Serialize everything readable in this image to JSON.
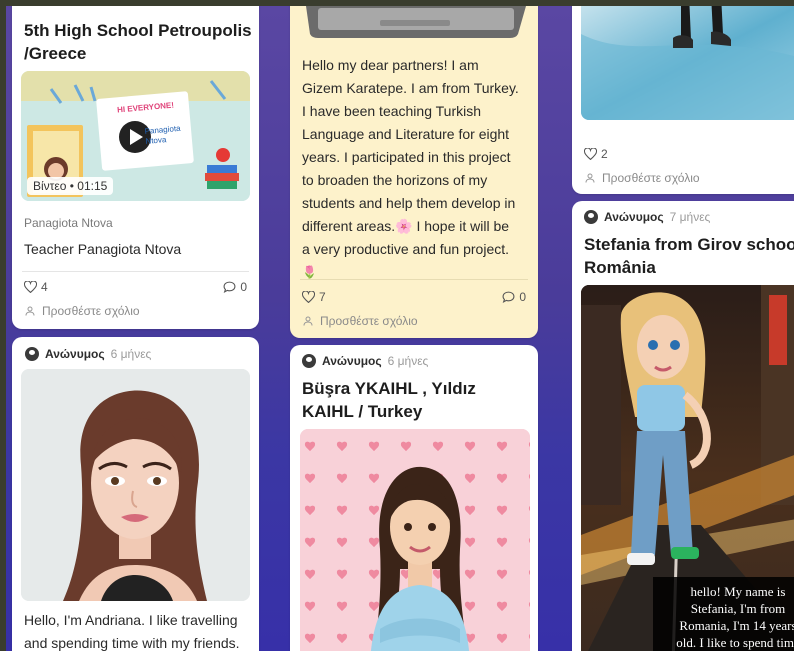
{
  "cards": {
    "petroupolis": {
      "title_line1": "5th High School Petroupolis",
      "title_line2": "/Greece",
      "thumb_greeting": "HI EVERYONE!",
      "thumb_name": "Panagiota Ntova",
      "video_badge": "Βίντεο • 01:15",
      "attachment_name": "Panagiota Ntova",
      "body": "Teacher Panagiota Ntova",
      "likes": "4",
      "comments": "0",
      "add_comment": "Προσθέστε σχόλιο"
    },
    "andriana": {
      "author": "Ανώνυμος",
      "time": "6 μήνες",
      "body_line1": "Hello, I'm Andriana. I like travelling",
      "body_line2": "and spending time with my friends."
    },
    "gizem": {
      "body": [
        "Hello my dear partners! I am",
        "Gizem Karatepe. I am from Turkey.",
        "I have been teaching Turkish",
        "Language and Literature for eight",
        "years. I participated in this project",
        "to broaden the horizons of my",
        "students and help them develop in",
        "different areas.🌸 I hope it will be",
        "a very productive and fun project.",
        "🌷"
      ],
      "likes": "7",
      "comments": "0",
      "add_comment": "Προσθέστε σχόλιο"
    },
    "busra": {
      "author": "Ανώνυμος",
      "time": "6 μήνες",
      "title_line1": "Büşra YKAIHL , Yıldız",
      "title_line2": "KAIHL / Turkey"
    },
    "top_right": {
      "likes": "2",
      "add_comment": "Προσθέστε σχόλιο"
    },
    "stefania": {
      "author": "Ανώνυμος",
      "time": "7 μήνες",
      "title_line1": "Stefania from Girov school",
      "title_line2": "România",
      "caption": [
        "hello! My name is",
        "Stefania, I'm from",
        "Romania, I'm 14 years",
        "old. I like to spend time"
      ]
    }
  }
}
